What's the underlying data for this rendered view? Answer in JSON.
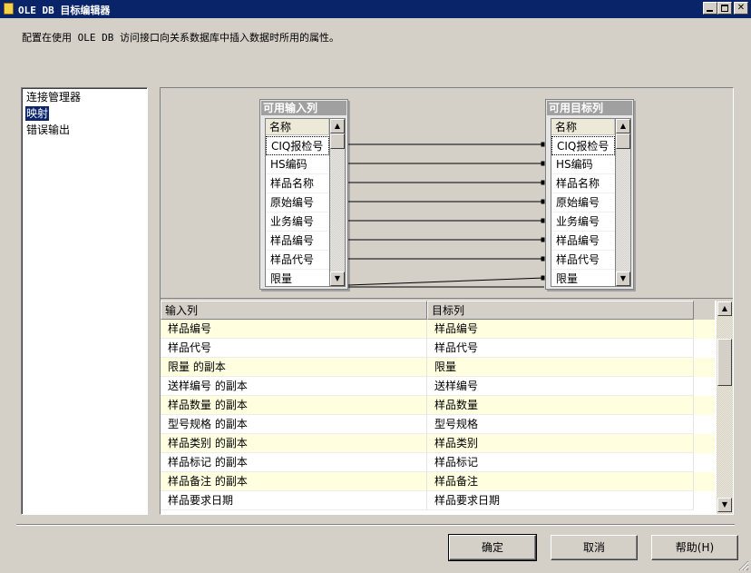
{
  "window": {
    "title": "OLE DB 目标编辑器",
    "minimize_label": "_",
    "close_label": "✕"
  },
  "description": "配置在使用 OLE DB 访问接口向关系数据库中插入数据时所用的属性。",
  "nav": {
    "items": [
      {
        "label": "连接管理器",
        "selected": false
      },
      {
        "label": "映射",
        "selected": true
      },
      {
        "label": "错误输出",
        "selected": false
      }
    ]
  },
  "mapping": {
    "input_box": {
      "title": "可用输入列",
      "header": "名称",
      "rows": [
        "CIQ报检号",
        "HS编码",
        "样品名称",
        "原始编号",
        "业务编号",
        "样品编号",
        "样品代号",
        "限量"
      ]
    },
    "target_box": {
      "title": "可用目标列",
      "header": "名称",
      "rows": [
        "CIQ报检号",
        "HS编码",
        "样品名称",
        "原始编号",
        "业务编号",
        "样品编号",
        "样品代号",
        "限量"
      ]
    }
  },
  "grid": {
    "headers": [
      "输入列",
      "目标列"
    ],
    "rows": [
      [
        "样品编号",
        "样品编号"
      ],
      [
        "样品代号",
        "样品代号"
      ],
      [
        "限量 的副本",
        "限量"
      ],
      [
        "送样编号 的副本",
        "送样编号"
      ],
      [
        "样品数量 的副本",
        "样品数量"
      ],
      [
        "型号规格 的副本",
        "型号规格"
      ],
      [
        "样品类别 的副本",
        "样品类别"
      ],
      [
        "样品标记 的副本",
        "样品标记"
      ],
      [
        "样品备注 的副本",
        "样品备注"
      ],
      [
        "样品要求日期",
        "样品要求日期"
      ]
    ]
  },
  "buttons": {
    "ok": "确定",
    "cancel": "取消",
    "help": "帮助(H)"
  }
}
